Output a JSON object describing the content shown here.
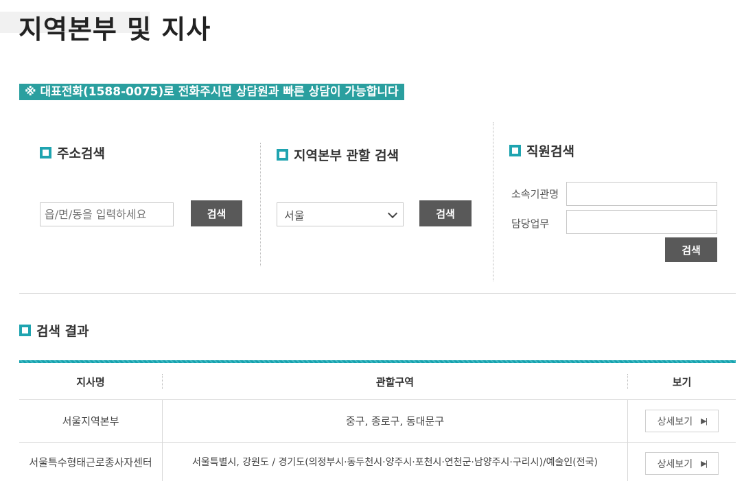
{
  "page": {
    "title": "지역본부 및 지사",
    "notice": "※ 대표전화(1588-0075)로 전화주시면 상담원과 빠른 상담이 가능합니다"
  },
  "address_search": {
    "heading": "주소검색",
    "placeholder": "읍/면/동을 입력하세요",
    "button": "검색"
  },
  "region_search": {
    "heading": "지역본부 관할 검색",
    "selected": "서울",
    "button": "검색"
  },
  "staff_search": {
    "heading": "직원검색",
    "org_label": "소속기관명",
    "duty_label": "담당업무",
    "button": "검색"
  },
  "results": {
    "heading": "검색 결과",
    "columns": [
      "지사명",
      "관할구역",
      "보기"
    ],
    "rows": [
      {
        "name": "서울지역본부",
        "area": "중구, 종로구, 동대문구",
        "action": "상세보기"
      },
      {
        "name": "서울특수형태근로종사자센터",
        "area": "서울특별시, 강원도 / 경기도(의정부시·동두천시·양주시·포천시·연천군·남양주시·구리시)/예술인(전국)",
        "action": "상세보기"
      }
    ]
  },
  "colors": {
    "accent": "#1fa4b0",
    "notice_bg": "#2a9f9f",
    "button_bg": "#595959"
  },
  "icons": {
    "section": "square-bullet-icon",
    "play": "play-icon",
    "dropdown": "chevron-down-icon"
  }
}
